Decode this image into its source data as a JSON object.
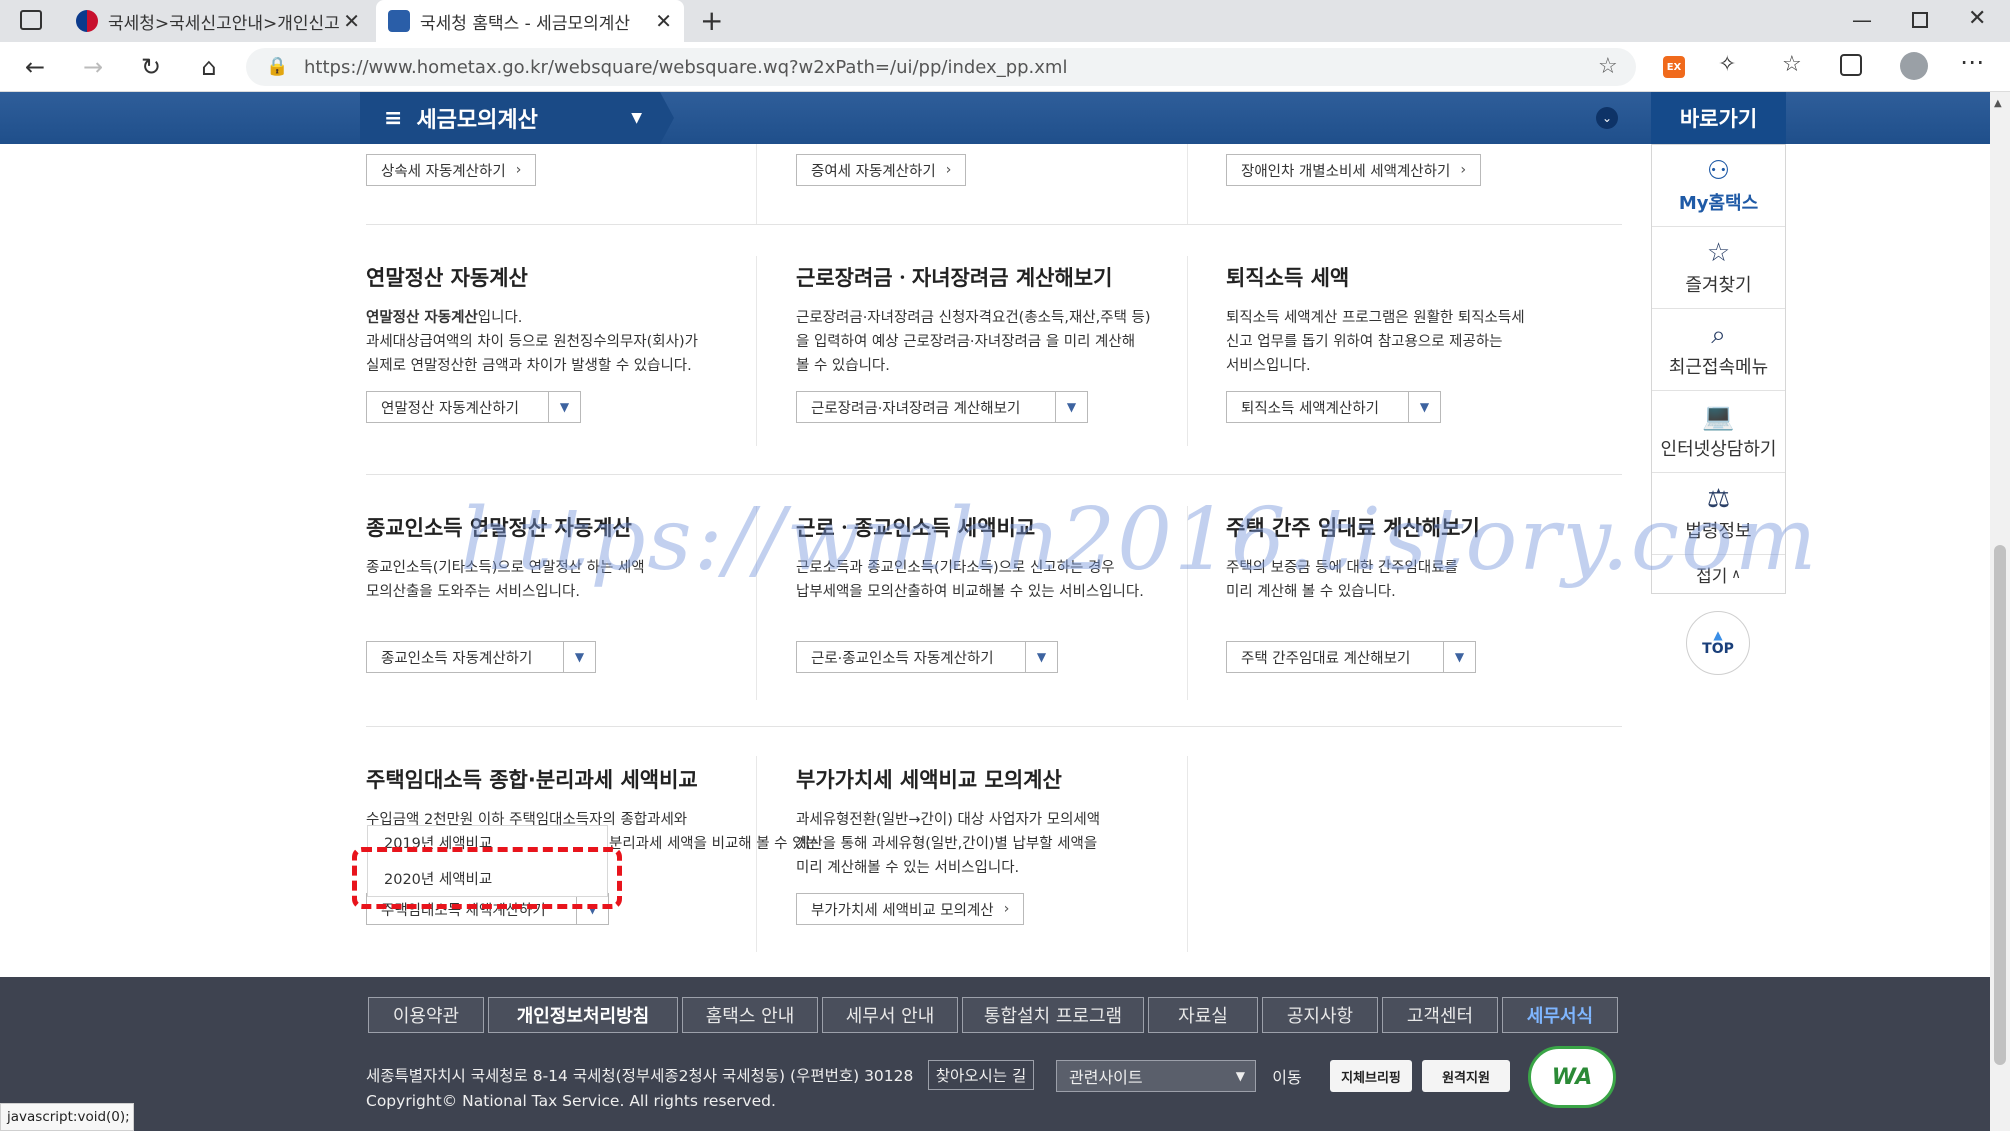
{
  "browser": {
    "tabs": [
      {
        "title": "국세청>국세신고안내>개인신고"
      },
      {
        "title": "국세청 홈택스 - 세금모의계산"
      }
    ],
    "url": "https://www.hometax.go.kr/websquare/websquare.wq?w2xPath=/ui/pp/index_pp.xml",
    "ext_label": "EX"
  },
  "header": {
    "menu_title": "세금모의계산",
    "quick_title": "바로가기"
  },
  "quick_menu": {
    "items": [
      {
        "label": "My홈택스",
        "icon": "person-icon"
      },
      {
        "label": "즐겨찾기",
        "icon": "star-icon"
      },
      {
        "label": "최근접속메뉴",
        "icon": "recent-search-icon"
      },
      {
        "label": "인터넷상담하기",
        "icon": "laptop-icon"
      },
      {
        "label": "법령정보",
        "icon": "gavel-icon"
      }
    ],
    "fold_label": "접기",
    "top_label": "TOP"
  },
  "top_buttons": [
    "상속세 자동계산하기",
    "증여세 자동계산하기",
    "장애인차 개별소비세 세액계산하기"
  ],
  "sections": [
    {
      "title": "연말정산 자동계산",
      "desc_bold": "연말정산 자동계산",
      "desc_lines": [
        "입니다.",
        "과세대상급여액의 차이 등으로 원천징수의무자(회사)가",
        "실제로 연말정산한 금액과 차이가 발생할 수 있습니다."
      ],
      "button": "연말정산 자동계산하기"
    },
    {
      "title": "근로장려금ㆍ자녀장려금 계산해보기",
      "desc_lines": [
        "근로장려금·자녀장려금 신청자격요건(총소득,재산,주택 등)",
        "을 입력하여 예상 근로장려금·자녀장려금 을 미리 계산해",
        "볼 수 있습니다."
      ],
      "button": "근로장려금·자녀장려금 계산해보기"
    },
    {
      "title": "퇴직소득 세액",
      "desc_lines": [
        "퇴직소득 세액계산 프로그램은 원활한 퇴직소득세",
        "신고 업무를 돕기 위하여 참고용으로 제공하는",
        "서비스입니다."
      ],
      "button": "퇴직소득 세액계산하기"
    },
    {
      "title": "종교인소득 연말정산 자동계산",
      "desc_lines": [
        "종교인소득(기타소득)으로 연말정산 하는 세액",
        "모의산출을 도와주는 서비스입니다."
      ],
      "button": "종교인소득 자동계산하기"
    },
    {
      "title": "근로ㆍ종교인소득 세액비교",
      "desc_lines": [
        "근로소득과 종교인소득(기타소득)으로 신고하는 경우",
        "납부세액을 모의산출하여 비교해볼 수 있는 서비스입니다."
      ],
      "button": "근로·종교인소득 자동계산하기"
    },
    {
      "title": "주택 간주 임대료 계산해보기",
      "desc_lines": [
        "주택의 보증금 등에 대한 간주임대료를",
        "미리 계산해 볼 수 있습니다."
      ],
      "button": "주택 간주임대료 계산해보기"
    },
    {
      "title": "주택임대소득 종합·분리과세 세액비교",
      "desc_lines": [
        "수입금액 2천만원 이하 주택임대소득자의 종합과세와",
        "분리과세 세액을 비교해 볼 수 있는"
      ],
      "button": "주택임대소득 세액계산하기"
    },
    {
      "title": "부가가치세 세액비교 모의계산",
      "desc_lines": [
        "과세유형전환(일반→간이) 대상 사업자가 모의세액",
        "계산을 통해 과세유형(일반,간이)별 납부할 세액을",
        "미리 계산해볼 수 있는 서비스입니다."
      ],
      "button": "부가가치세 세액비교 모의계산"
    }
  ],
  "popup": {
    "options": [
      "2019년 세액비교",
      "2020년 세액비교"
    ]
  },
  "footer": {
    "links": [
      "이용약관",
      "개인정보처리방침",
      "홈택스 안내",
      "세무서 안내",
      "통합설치 프로그램",
      "자료실",
      "공지사항",
      "고객센터",
      "세무서식"
    ],
    "address": "세종특별자치시 국세청로 8-14 국세청(정부세종2청사 국세청동) (우편번호) 30128",
    "directions": "찾아오시는 길",
    "related_select": "관련사이트",
    "go": "이동",
    "badge1": "지체브리핑",
    "badge2": "원격지원",
    "wa": "WA",
    "copyright": "Copyright© National Tax Service. All rights reserved."
  },
  "status_bar": "javascript:void(0);",
  "watermark": "https://wmhn2016.tistory.com",
  "colors": {
    "header_blue": "#1f4f8b",
    "footer_bg": "#3e4350",
    "highlight_red": "#e8141c"
  }
}
